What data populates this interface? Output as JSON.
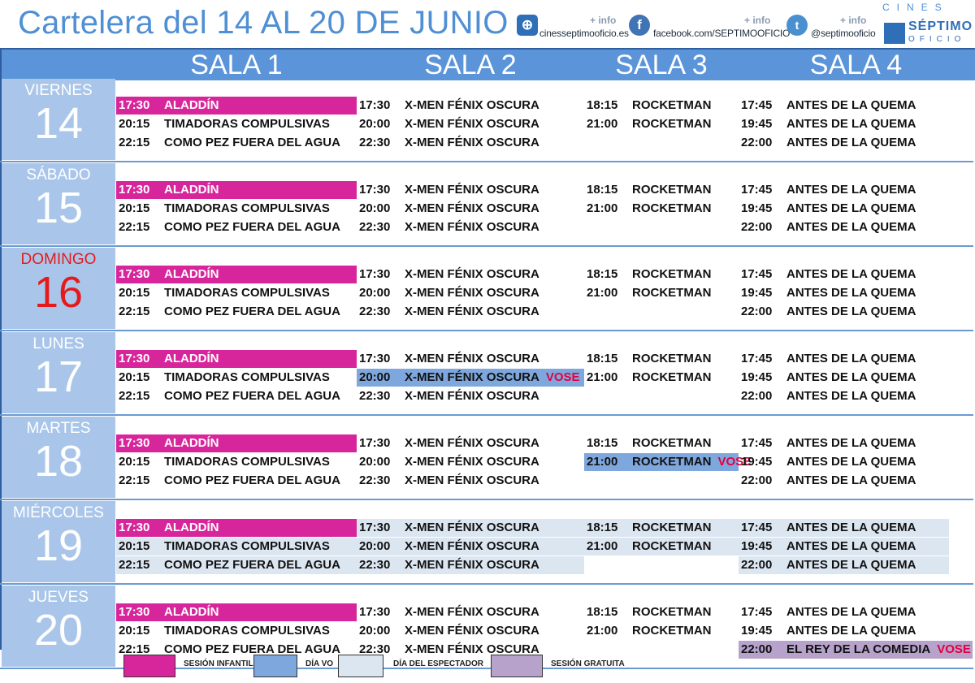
{
  "title": "Cartelera del 14 AL 20 DE JUNIO",
  "social": {
    "more_label": "+ info",
    "web": "cinesseptimooficio.es",
    "facebook": "facebook.com/SEPTIMOOFICIO",
    "twitter": "@septimooficio"
  },
  "brand": {
    "top": "CINES",
    "name": "SÉPTIMO",
    "sub": "OFICIO"
  },
  "salas": [
    "SALA 1",
    "SALA 2",
    "SALA 3",
    "SALA 4"
  ],
  "days": [
    {
      "name": "VIERNES",
      "num": "14",
      "s1": [
        {
          "time": "17:30",
          "film": "ALADDÍN"
        },
        {
          "time": "20:15",
          "film": "TIMADORAS COMPULSIVAS"
        },
        {
          "time": "22:15",
          "film": "COMO PEZ FUERA DEL AGUA"
        }
      ],
      "s2": [
        {
          "time": "17:30",
          "film": "X-MEN  FÉNIX OSCURA"
        },
        {
          "time": "20:00",
          "film": "X-MEN  FÉNIX OSCURA"
        },
        {
          "time": "22:30",
          "film": "X-MEN  FÉNIX OSCURA"
        }
      ],
      "s3": [
        {
          "time": "18:15",
          "film": "ROCKETMAN"
        },
        {
          "time": "21:00",
          "film": "ROCKETMAN"
        }
      ],
      "s4": [
        {
          "time": "17:45",
          "film": "ANTES DE LA QUEMA"
        },
        {
          "time": "19:45",
          "film": "ANTES DE LA QUEMA"
        },
        {
          "time": "22:00",
          "film": "ANTES DE LA QUEMA"
        }
      ]
    },
    {
      "name": "SÁBADO",
      "num": "15",
      "s1": [
        {
          "time": "17:30",
          "film": "ALADDÍN"
        },
        {
          "time": "20:15",
          "film": "TIMADORAS COMPULSIVAS"
        },
        {
          "time": "22:15",
          "film": "COMO PEZ FUERA DEL AGUA"
        }
      ],
      "s2": [
        {
          "time": "17:30",
          "film": "X-MEN  FÉNIX OSCURA"
        },
        {
          "time": "20:00",
          "film": "X-MEN  FÉNIX OSCURA"
        },
        {
          "time": "22:30",
          "film": "X-MEN  FÉNIX OSCURA"
        }
      ],
      "s3": [
        {
          "time": "18:15",
          "film": "ROCKETMAN"
        },
        {
          "time": "21:00",
          "film": "ROCKETMAN"
        }
      ],
      "s4": [
        {
          "time": "17:45",
          "film": "ANTES DE LA QUEMA"
        },
        {
          "time": "19:45",
          "film": "ANTES DE LA QUEMA"
        },
        {
          "time": "22:00",
          "film": "ANTES DE LA QUEMA"
        }
      ]
    },
    {
      "name": "DOMINGO",
      "num": "16",
      "s1": [
        {
          "time": "17:30",
          "film": "ALADDÍN"
        },
        {
          "time": "20:15",
          "film": "TIMADORAS COMPULSIVAS"
        },
        {
          "time": "22:15",
          "film": "COMO PEZ FUERA DEL AGUA"
        }
      ],
      "s2": [
        {
          "time": "17:30",
          "film": "X-MEN  FÉNIX OSCURA"
        },
        {
          "time": "20:00",
          "film": "X-MEN  FÉNIX OSCURA"
        },
        {
          "time": "22:30",
          "film": "X-MEN  FÉNIX OSCURA"
        }
      ],
      "s3": [
        {
          "time": "18:15",
          "film": "ROCKETMAN"
        },
        {
          "time": "21:00",
          "film": "ROCKETMAN"
        }
      ],
      "s4": [
        {
          "time": "17:45",
          "film": "ANTES DE LA QUEMA"
        },
        {
          "time": "19:45",
          "film": "ANTES DE LA QUEMA"
        },
        {
          "time": "22:00",
          "film": "ANTES DE LA QUEMA"
        }
      ]
    },
    {
      "name": "LUNES",
      "num": "17",
      "s1": [
        {
          "time": "17:30",
          "film": "ALADDÍN"
        },
        {
          "time": "20:15",
          "film": "TIMADORAS COMPULSIVAS"
        },
        {
          "time": "22:15",
          "film": "COMO PEZ FUERA DEL AGUA"
        }
      ],
      "s2": [
        {
          "time": "17:30",
          "film": "X-MEN  FÉNIX OSCURA"
        },
        {
          "time": "20:00",
          "film": "X-MEN  FÉNIX OSCURA",
          "vose": "VOSE"
        },
        {
          "time": "22:30",
          "film": "X-MEN  FÉNIX OSCURA"
        }
      ],
      "s3": [
        {
          "time": "18:15",
          "film": "ROCKETMAN"
        },
        {
          "time": "21:00",
          "film": "ROCKETMAN"
        }
      ],
      "s4": [
        {
          "time": "17:45",
          "film": "ANTES DE LA QUEMA"
        },
        {
          "time": "19:45",
          "film": "ANTES DE LA QUEMA"
        },
        {
          "time": "22:00",
          "film": "ANTES DE LA QUEMA"
        }
      ]
    },
    {
      "name": "MARTES",
      "num": "18",
      "s1": [
        {
          "time": "17:30",
          "film": "ALADDÍN"
        },
        {
          "time": "20:15",
          "film": "TIMADORAS COMPULSIVAS"
        },
        {
          "time": "22:15",
          "film": "COMO PEZ FUERA DEL AGUA"
        }
      ],
      "s2": [
        {
          "time": "17:30",
          "film": "X-MEN  FÉNIX OSCURA"
        },
        {
          "time": "20:00",
          "film": "X-MEN  FÉNIX OSCURA"
        },
        {
          "time": "22:30",
          "film": "X-MEN  FÉNIX OSCURA"
        }
      ],
      "s3": [
        {
          "time": "18:15",
          "film": "ROCKETMAN"
        },
        {
          "time": "21:00",
          "film": "ROCKETMAN",
          "vose": "VOSE"
        }
      ],
      "s4": [
        {
          "time": "17:45",
          "film": "ANTES DE LA QUEMA"
        },
        {
          "time": "19:45",
          "film": "ANTES DE LA QUEMA"
        },
        {
          "time": "22:00",
          "film": "ANTES DE LA QUEMA"
        }
      ]
    },
    {
      "name": "MIÉRCOLES",
      "num": "19",
      "s1": [
        {
          "time": "17:30",
          "film": "ALADDÍN"
        },
        {
          "time": "20:15",
          "film": "TIMADORAS COMPULSIVAS"
        },
        {
          "time": "22:15",
          "film": "COMO PEZ FUERA DEL AGUA"
        }
      ],
      "s2": [
        {
          "time": "17:30",
          "film": "X-MEN  FÉNIX OSCURA"
        },
        {
          "time": "20:00",
          "film": "X-MEN  FÉNIX OSCURA"
        },
        {
          "time": "22:30",
          "film": "X-MEN  FÉNIX OSCURA"
        }
      ],
      "s3": [
        {
          "time": "18:15",
          "film": "ROCKETMAN"
        },
        {
          "time": "21:00",
          "film": "ROCKETMAN"
        }
      ],
      "s4": [
        {
          "time": "17:45",
          "film": "ANTES DE LA QUEMA"
        },
        {
          "time": "19:45",
          "film": "ANTES DE LA QUEMA"
        },
        {
          "time": "22:00",
          "film": "ANTES DE LA QUEMA"
        }
      ]
    },
    {
      "name": "JUEVES",
      "num": "20",
      "s1": [
        {
          "time": "17:30",
          "film": "ALADDÍN"
        },
        {
          "time": "20:15",
          "film": "TIMADORAS COMPULSIVAS"
        },
        {
          "time": "22:15",
          "film": "COMO PEZ FUERA DEL AGUA"
        }
      ],
      "s2": [
        {
          "time": "17:30",
          "film": "X-MEN  FÉNIX OSCURA"
        },
        {
          "time": "20:00",
          "film": "X-MEN  FÉNIX OSCURA"
        },
        {
          "time": "22:30",
          "film": "X-MEN  FÉNIX OSCURA"
        }
      ],
      "s3": [
        {
          "time": "18:15",
          "film": "ROCKETMAN"
        },
        {
          "time": "21:00",
          "film": "ROCKETMAN"
        }
      ],
      "s4": [
        {
          "time": "17:45",
          "film": "ANTES DE LA QUEMA"
        },
        {
          "time": "19:45",
          "film": "ANTES DE LA QUEMA"
        },
        {
          "time": "22:00",
          "film": "EL REY DE LA COMEDIA",
          "vose": "VOSE"
        }
      ]
    }
  ],
  "legend": {
    "infantil": "SESIÓN INFANTIL",
    "dia_vo": "DÍA VO",
    "espectador": "DÍA DEL ESPECTADOR",
    "gratuita": "SESIÓN GRATUITA"
  },
  "colors": {
    "infantil": "#d7269b",
    "dia_vo": "#7ea7dd",
    "espectador": "#dce6f1",
    "gratuita": "#b7a2cc",
    "header": "#5b94d8",
    "day_box": "#a9c6ea",
    "sunday": "#e41a1c"
  }
}
